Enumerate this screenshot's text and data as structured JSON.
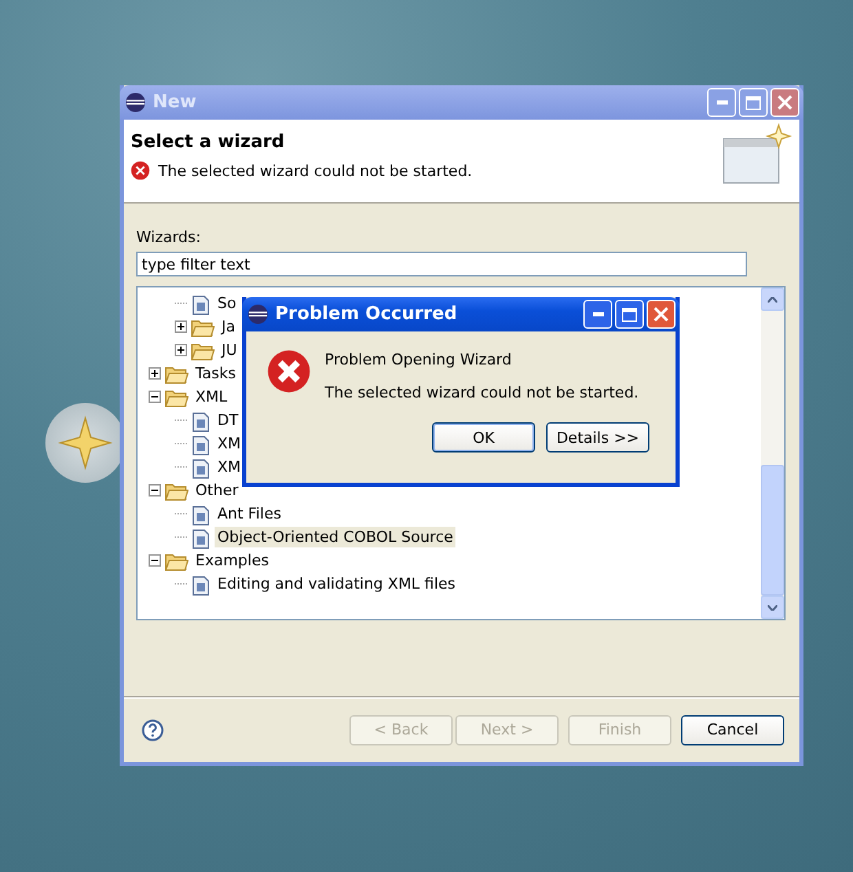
{
  "window": {
    "title": "New"
  },
  "header": {
    "title": "Select a wizard",
    "message": "The selected wizard could not be started."
  },
  "filter": {
    "label": "Wizards:",
    "value": "type filter text"
  },
  "tree": [
    {
      "children": [
        {
          "label": "So",
          "kind": "file",
          "selected": false
        },
        {
          "label": "Ja",
          "kind": "folder",
          "expanded": false,
          "selected": false
        },
        {
          "label": "JU",
          "kind": "folder",
          "expanded": false,
          "selected": false
        }
      ]
    },
    {
      "label": "Tasks",
      "kind": "folder",
      "expanded": false,
      "selected": false
    },
    {
      "label": "XML",
      "kind": "folder",
      "expanded": true,
      "selected": false,
      "children": [
        {
          "label": "DT",
          "kind": "file",
          "selected": false
        },
        {
          "label": "XM",
          "kind": "file",
          "selected": false
        },
        {
          "label": "XM",
          "kind": "file",
          "selected": false
        }
      ]
    },
    {
      "label": "Other",
      "kind": "folder",
      "expanded": true,
      "selected": false,
      "children": [
        {
          "label": "Ant Files",
          "kind": "file",
          "selected": false
        },
        {
          "label": "Object-Oriented COBOL Source",
          "kind": "file",
          "selected": true
        }
      ]
    },
    {
      "label": "Examples",
      "kind": "folder",
      "expanded": true,
      "selected": false,
      "children": [
        {
          "label": "Editing and validating XML files",
          "kind": "file",
          "selected": false
        }
      ]
    }
  ],
  "buttons": [
    {
      "label": "< Back",
      "disabled": true
    },
    {
      "label": "Next >",
      "disabled": true
    },
    {
      "label": "Finish",
      "disabled": true
    },
    {
      "label": "Cancel",
      "disabled": false
    }
  ],
  "dialog": {
    "title": "Problem Occurred",
    "heading": "Problem Opening Wizard",
    "message": "The selected wizard could not be started.",
    "buttons": [
      {
        "label": "OK",
        "default": true
      },
      {
        "label": "Details >>",
        "default": false
      }
    ]
  }
}
